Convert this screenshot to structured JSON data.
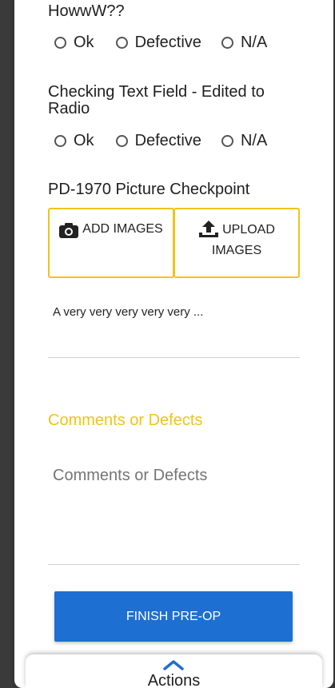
{
  "questions": [
    {
      "title": "HowwW??",
      "options": [
        "Ok",
        "Defective",
        "N/A"
      ]
    },
    {
      "title": "Checking Text Field - Edited to Radio",
      "options": [
        "Ok",
        "Defective",
        "N/A"
      ]
    }
  ],
  "picture_checkpoint": {
    "title": "PD-1970 Picture Checkpoint",
    "add_images_label": "ADD IMAGES",
    "upload_images_label_line1": "UPLOAD",
    "upload_images_label_line2": "IMAGES",
    "add_icon": "camera-icon",
    "upload_icon": "upload-icon"
  },
  "text_answer": "A very very very very very ...",
  "comments": {
    "section_title": "Comments or Defects",
    "placeholder": "Comments or Defects"
  },
  "finish_button": "FINISH PRE-OP",
  "actions": {
    "label": "Actions",
    "icon": "chevron-up-icon"
  },
  "colors": {
    "accent_yellow": "#f0c419",
    "primary_blue": "#1e6fd2",
    "background_dark": "#3a3a3a"
  }
}
